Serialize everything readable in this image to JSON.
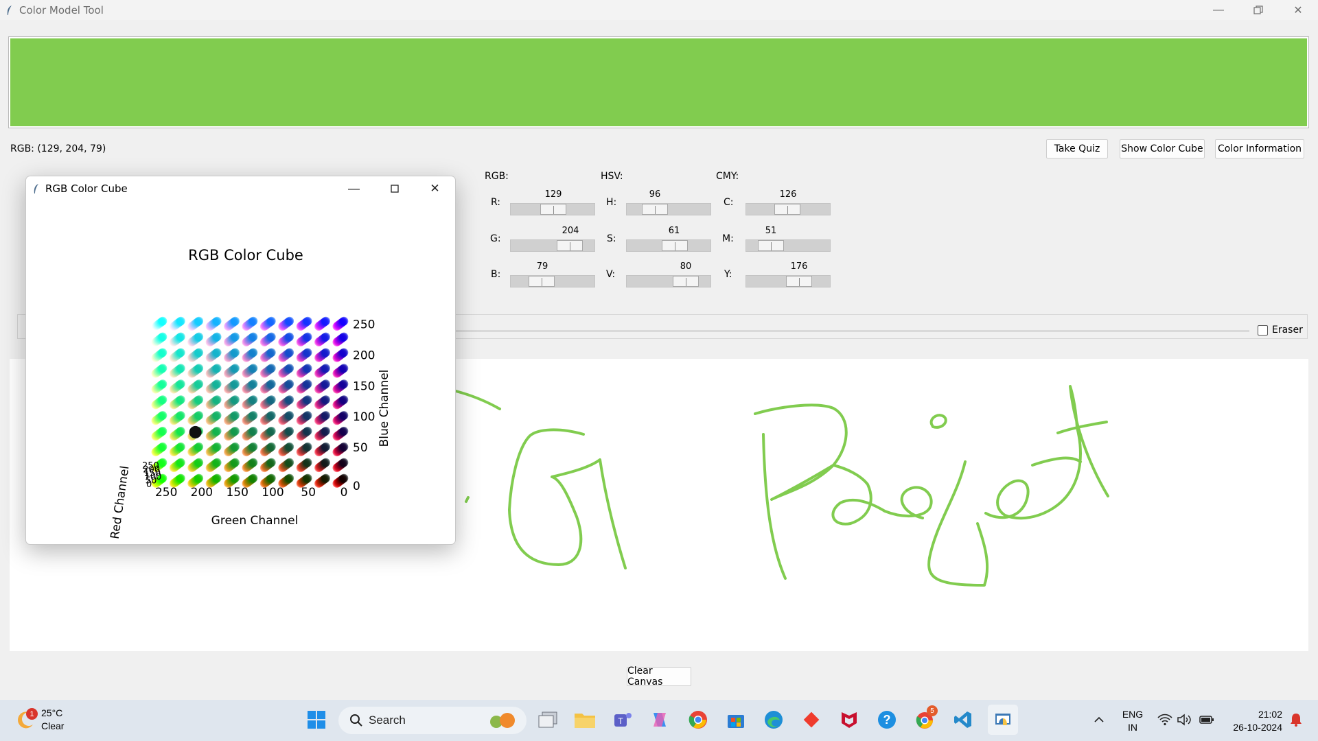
{
  "app": {
    "title": "Color Model Tool",
    "current_color": "#81cc4f"
  },
  "status": {
    "rgb_readout": "RGB: (129, 204, 79)"
  },
  "buttons": {
    "take_quiz": "Take Quiz",
    "show_color_cube": "Show Color Cube",
    "color_information": "Color Information",
    "clear_canvas": "Clear Canvas"
  },
  "sliders": {
    "rgb": {
      "label": "RGB:",
      "channels": [
        {
          "label": "R:",
          "value": "129",
          "fraction": 0.506
        },
        {
          "label": "G:",
          "value": "204",
          "fraction": 0.8
        },
        {
          "label": "B:",
          "value": "79",
          "fraction": 0.31
        }
      ]
    },
    "hsv": {
      "label": "HSV:",
      "channels": [
        {
          "label": "H:",
          "value": "96",
          "fraction": 0.267
        },
        {
          "label": "S:",
          "value": "61",
          "fraction": 0.61
        },
        {
          "label": "V:",
          "value": "80",
          "fraction": 0.8
        }
      ]
    },
    "cmy": {
      "label": "CMY:",
      "channels": [
        {
          "label": "C:",
          "value": "126",
          "fraction": 0.494
        },
        {
          "label": "M:",
          "value": "51",
          "fraction": 0.2
        },
        {
          "label": "Y:",
          "value": "176",
          "fraction": 0.69
        }
      ]
    }
  },
  "toolbar": {
    "eraser_label": "Eraser",
    "eraser_checked": false
  },
  "canvas": {
    "stroke_color": "#81cc4f"
  },
  "cube_window": {
    "title": "RGB Color Cube",
    "chart_title": "RGB Color Cube",
    "blue_axis_label": "Blue Channel",
    "green_axis_label": "Green Channel",
    "red_axis_label": "Red Channel",
    "blue_ticks": [
      "250",
      "200",
      "150",
      "100",
      "50",
      "0"
    ],
    "green_ticks": [
      "250",
      "200",
      "150",
      "100",
      "50",
      "0"
    ],
    "red_ticks": [
      "250",
      "200",
      "150",
      "100",
      "50",
      "0"
    ],
    "grid_steps": 11,
    "marker_rgb": [
      129,
      204,
      79
    ]
  },
  "taskbar": {
    "weather_temp": "25°C",
    "weather_cond": "Clear",
    "weather_badge": "1",
    "search_placeholder": "Search",
    "chrome_badge": "5",
    "lang_line1": "ENG",
    "lang_line2": "IN",
    "time": "21:02",
    "date": "26-10-2024"
  }
}
